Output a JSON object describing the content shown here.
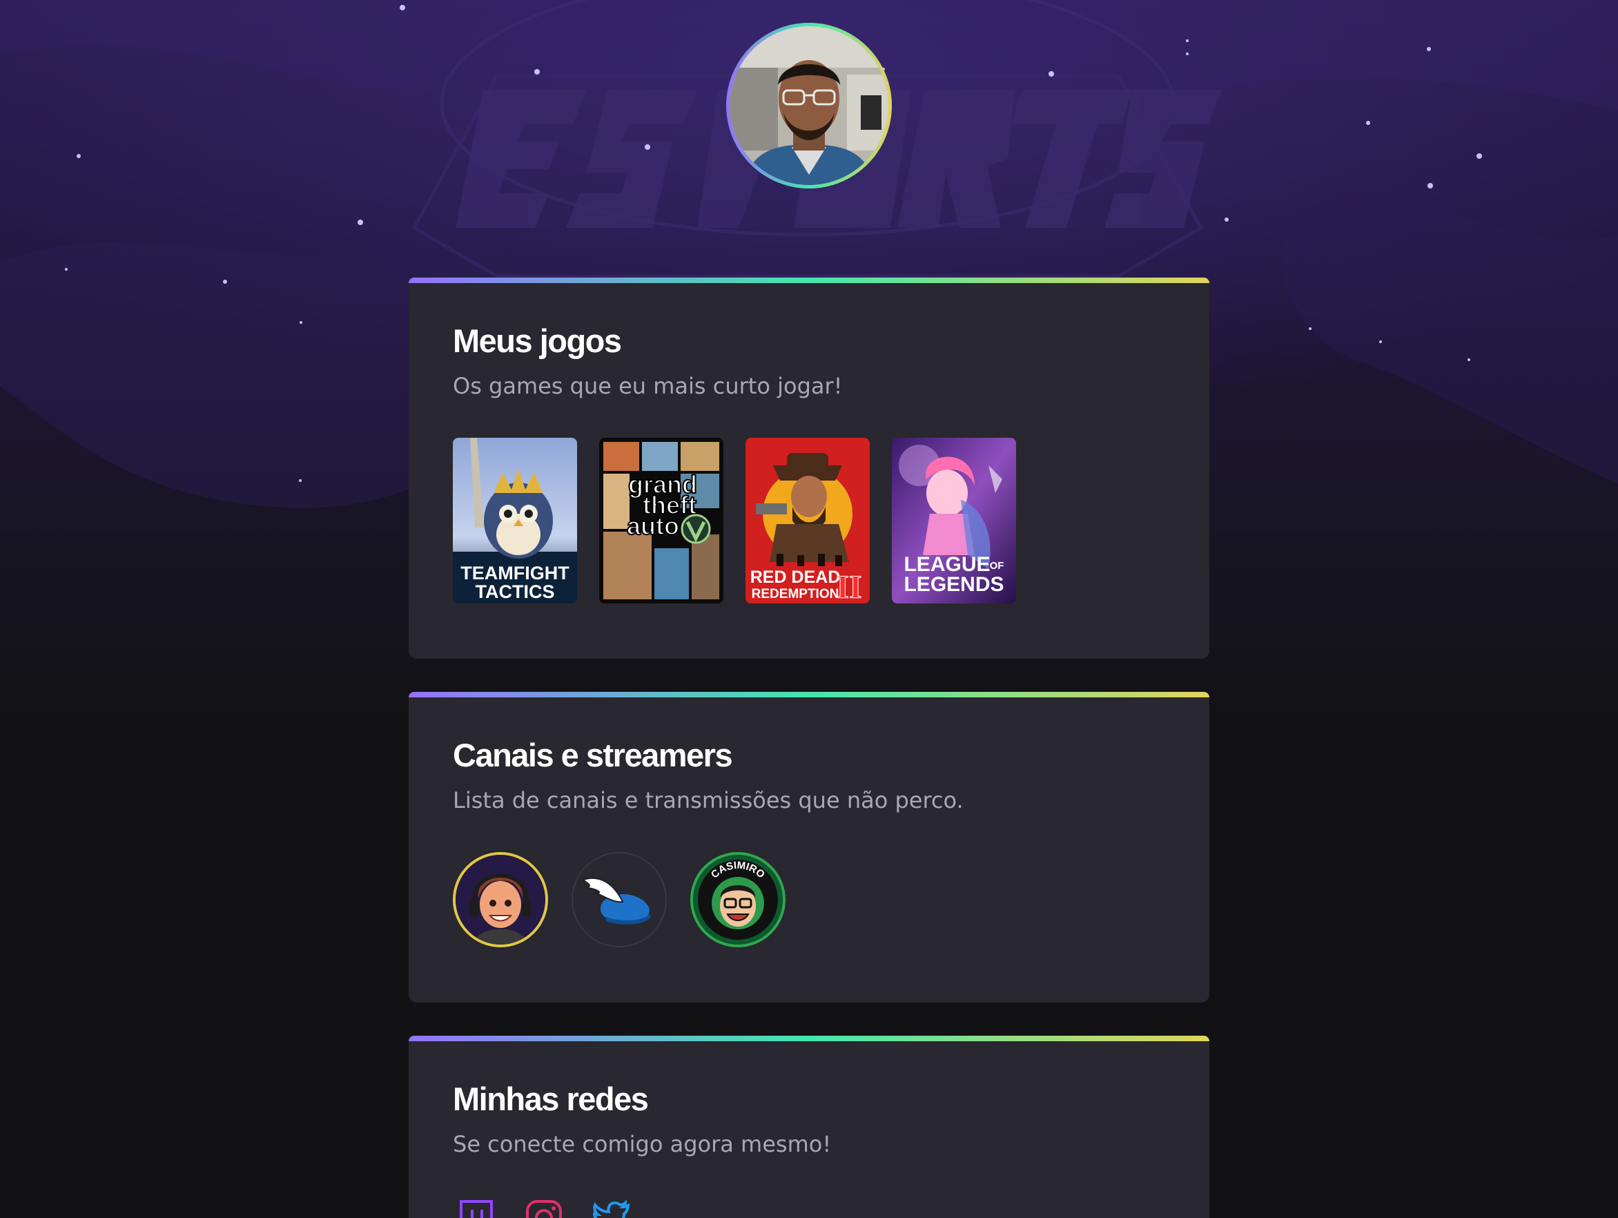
{
  "profile": {
    "avatar_alt": "profile-photo"
  },
  "games_section": {
    "title": "Meus jogos",
    "subtitle": "Os games que eu mais curto jogar!",
    "games": [
      {
        "name": "TEAMFIGHT TACTICS",
        "line1": "TEAMFIGHT",
        "line2": "TACTICS"
      },
      {
        "name": "grand theft auto V",
        "line1": "grand",
        "line2": "theft",
        "line3": "auto"
      },
      {
        "name": "RED DEAD REDEMPTION II",
        "line1": "RED DEAD",
        "line2": "REDEMPTION",
        "roman": "II"
      },
      {
        "name": "LEAGUE OF LEGENDS",
        "line1": "LEAGUE",
        "of": "OF",
        "line2": "LEGENDS"
      }
    ]
  },
  "streamers_section": {
    "title": "Canais e streamers",
    "subtitle": "Lista de canais e transmissões que não perco.",
    "streamers": [
      {
        "icon": "cartoon-boy-avatar"
      },
      {
        "icon": "winged-helmet-avatar"
      },
      {
        "icon": "casimiro-avatar",
        "badge_text": "CASIMIRO"
      }
    ]
  },
  "socials_section": {
    "title": "Minhas redes",
    "subtitle": "Se conecte comigo agora mesmo!",
    "links": [
      {
        "icon": "twitch-icon",
        "color": "#9146ff"
      },
      {
        "icon": "instagram-icon",
        "color": "#e1306c"
      },
      {
        "icon": "twitter-icon",
        "color": "#1d9bf0"
      }
    ]
  },
  "colors": {
    "gradient_start": "#9572fc",
    "gradient_mid": "#43e7ad",
    "gradient_end": "#e2d45c",
    "card_bg": "#29272f",
    "text_muted": "#a8a8b3"
  }
}
